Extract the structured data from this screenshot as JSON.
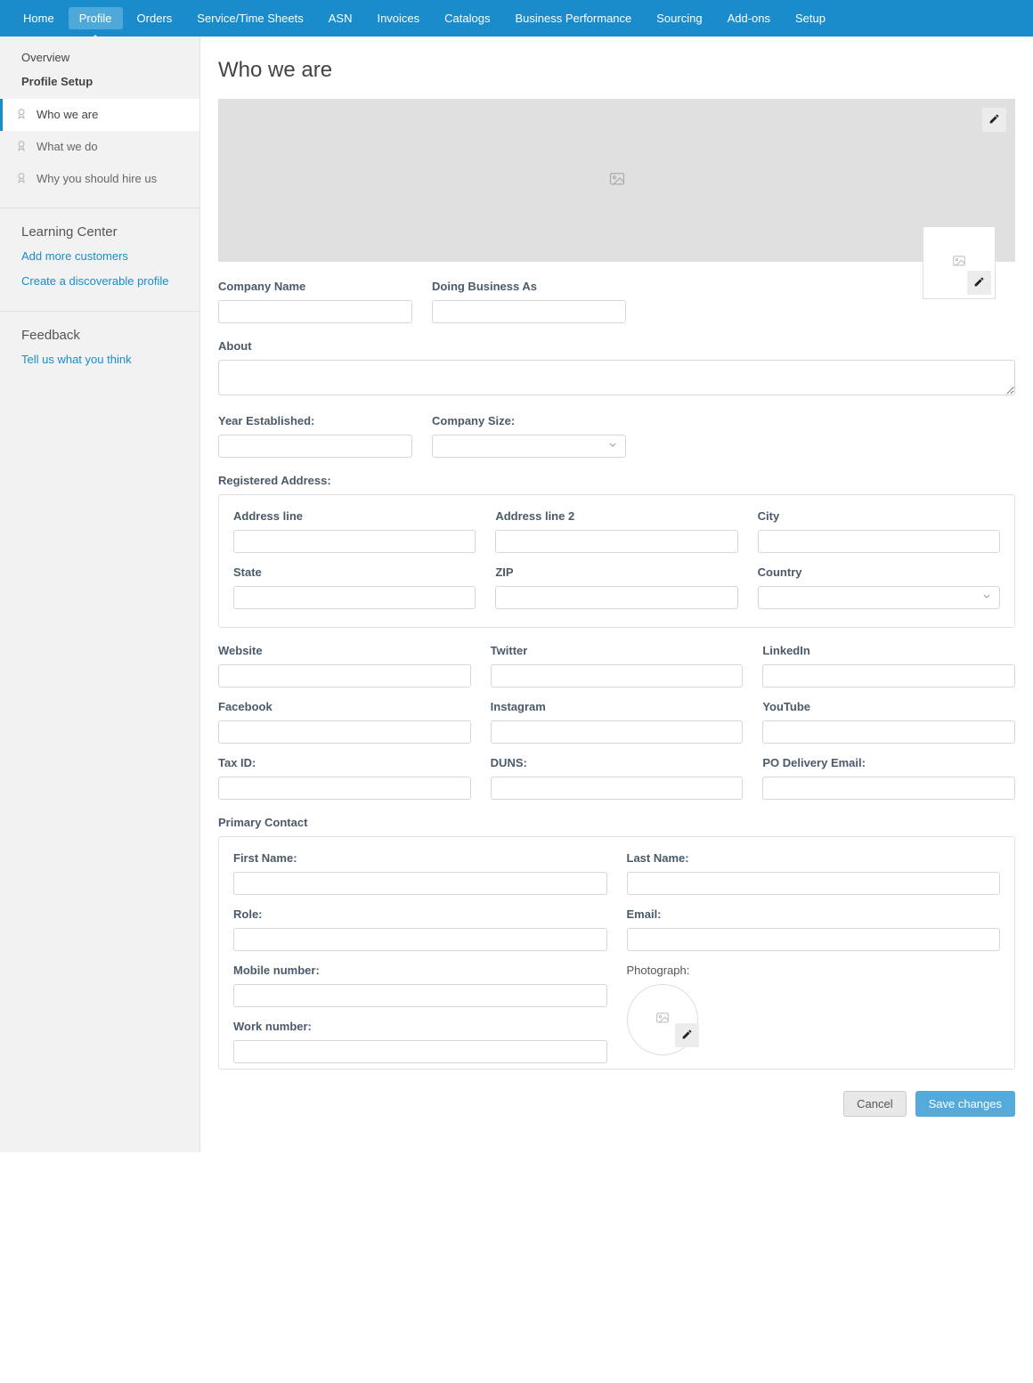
{
  "topnav": {
    "items": [
      "Home",
      "Profile",
      "Orders",
      "Service/Time Sheets",
      "ASN",
      "Invoices",
      "Catalogs",
      "Business Performance",
      "Sourcing",
      "Add-ons",
      "Setup"
    ],
    "activeIndex": 1
  },
  "sidebar": {
    "overview": "Overview",
    "profileSetup": "Profile Setup",
    "subItems": [
      {
        "label": "Who we are"
      },
      {
        "label": "What we do"
      },
      {
        "label": "Why you should hire us"
      }
    ],
    "activeSubIndex": 0,
    "learning": {
      "title": "Learning Center",
      "links": [
        "Add more customers",
        "Create a discoverable profile"
      ]
    },
    "feedback": {
      "title": "Feedback",
      "links": [
        "Tell us what you think"
      ]
    }
  },
  "page": {
    "title": "Who we are"
  },
  "labels": {
    "companyName": "Company Name",
    "dba": "Doing Business As",
    "about": "About",
    "yearEstablished": "Year Established:",
    "companySize": "Company Size:",
    "registeredAddress": "Registered Address:",
    "addressLine": "Address line",
    "addressLine2": "Address line 2",
    "city": "City",
    "state": "State",
    "zip": "ZIP",
    "country": "Country",
    "website": "Website",
    "twitter": "Twitter",
    "linkedin": "LinkedIn",
    "facebook": "Facebook",
    "instagram": "Instagram",
    "youtube": "YouTube",
    "taxId": "Tax ID:",
    "duns": "DUNS:",
    "poEmail": "PO Delivery Email:",
    "primaryContact": "Primary Contact",
    "firstName": "First Name:",
    "lastName": "Last Name:",
    "role": "Role:",
    "email": "Email:",
    "mobile": "Mobile number:",
    "work": "Work number:",
    "photo": "Photograph:"
  },
  "values": {
    "companyName": "",
    "dba": "",
    "about": "",
    "yearEstablished": "",
    "companySize": "",
    "addressLine": "",
    "addressLine2": "",
    "city": "",
    "state": "",
    "zip": "",
    "country": "",
    "website": "",
    "twitter": "",
    "linkedin": "",
    "facebook": "",
    "instagram": "",
    "youtube": "",
    "taxId": "",
    "duns": "",
    "poEmail": "",
    "firstName": "",
    "lastName": "",
    "role": "",
    "email": "",
    "mobile": "",
    "work": ""
  },
  "actions": {
    "cancel": "Cancel",
    "save": "Save changes"
  }
}
